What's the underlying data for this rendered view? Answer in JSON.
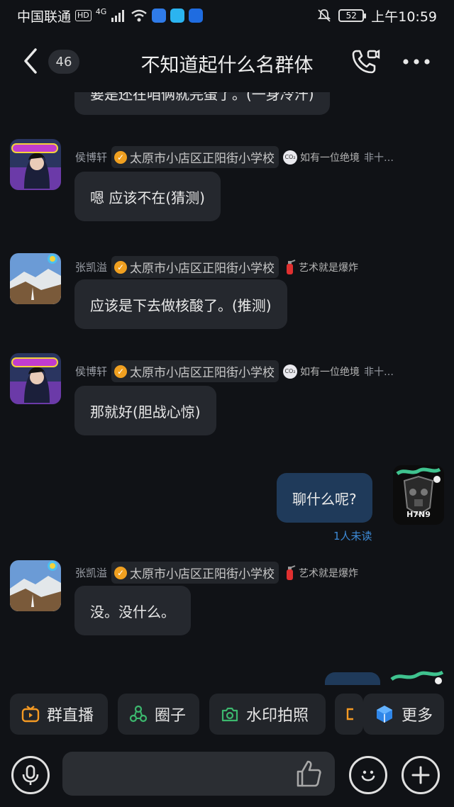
{
  "status_bar": {
    "carrier": "中国联通",
    "hd": "HD",
    "network": "4G",
    "battery": "52",
    "time": "上午10:59"
  },
  "header": {
    "unread_count": "46",
    "title": "不知道起什么名群体"
  },
  "messages": [
    {
      "sender": "",
      "text": "要是还在咱俩就完蛋了。(一身冷汗)",
      "partial": true
    },
    {
      "sender": "侯博轩",
      "school": "太原市小店区正阳街小学校",
      "honor_text": "如有一位绝境",
      "honor_suffix": "非十…",
      "honor_icon": "co2-badge-icon",
      "text": "嗯  应该不在(猜测)"
    },
    {
      "sender": "张凯溢",
      "school": "太原市小店区正阳街小学校",
      "honor_text": "艺术就是爆炸",
      "honor_icon": "fire-extinguisher-icon",
      "text": "应该是下去做核酸了。(推测)"
    },
    {
      "sender": "侯博轩",
      "school": "太原市小店区正阳街小学校",
      "honor_text": "如有一位绝境",
      "honor_suffix": "非十…",
      "honor_icon": "co2-badge-icon",
      "text": "那就好(胆战心惊)"
    },
    {
      "sender": "me",
      "text": "聊什么呢?",
      "read_status": "1人未读",
      "avatar_label": "H7N9"
    },
    {
      "sender": "张凯溢",
      "school": "太原市小店区正阳街小学校",
      "honor_text": "艺术就是爆炸",
      "honor_icon": "fire-extinguisher-icon",
      "text": "没。没什么。"
    }
  ],
  "toolbar": {
    "items": [
      {
        "label": "群直播",
        "icon": "tv-icon"
      },
      {
        "label": "圈子",
        "icon": "circle-nodes-icon"
      },
      {
        "label": "水印拍照",
        "icon": "camera-icon"
      },
      {
        "label": "更多",
        "icon": "cube-icon"
      }
    ]
  },
  "input": {
    "placeholder": ""
  },
  "colors": {
    "background": "#101216",
    "bubble_other": "#25282e",
    "bubble_self": "#1f3a5a",
    "read_status": "#3d8ad6",
    "badge_orange": "#f0a020",
    "toolbar_green": "#3cb86e",
    "toolbar_orange": "#f59a23"
  }
}
